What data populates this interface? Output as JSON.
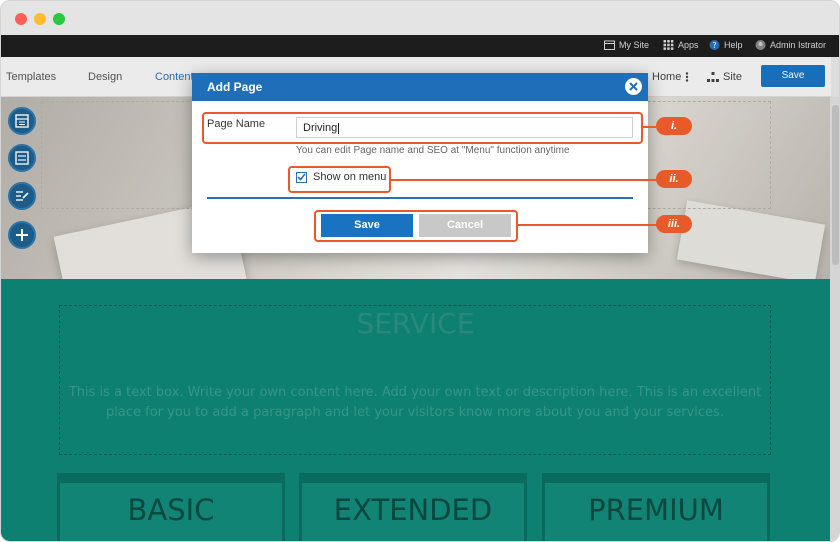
{
  "topbar": {
    "my_site": "My Site",
    "apps": "Apps",
    "help": "Help",
    "user": "Admin Istrator"
  },
  "editor": {
    "nav": [
      "Templates",
      "Design",
      "Content"
    ],
    "home": "Home",
    "site": "Site",
    "save": "Save"
  },
  "page": {
    "service_title": "SERVICE",
    "service_body": "This is a text box. Write your own content here. Add your own text or description here. This is an excellent place for you to add a paragraph and let your visitors know more about you and your services.",
    "cards": [
      "BASIC",
      "EXTENDED",
      "PREMIUM"
    ]
  },
  "dialog": {
    "title": "Add Page",
    "page_name_label": "Page Name",
    "page_name_value": "Driving",
    "hint": "You can edit Page name and SEO at \"Menu\" function anytime",
    "show_on_menu": "Show on menu",
    "show_on_menu_checked": true,
    "save": "Save",
    "cancel": "Cancel"
  },
  "callouts": [
    "i.",
    "ii.",
    "iii."
  ],
  "colors": {
    "accent": "#1f6eb8",
    "callout": "#e85a2a",
    "teal": "#0f8677"
  }
}
